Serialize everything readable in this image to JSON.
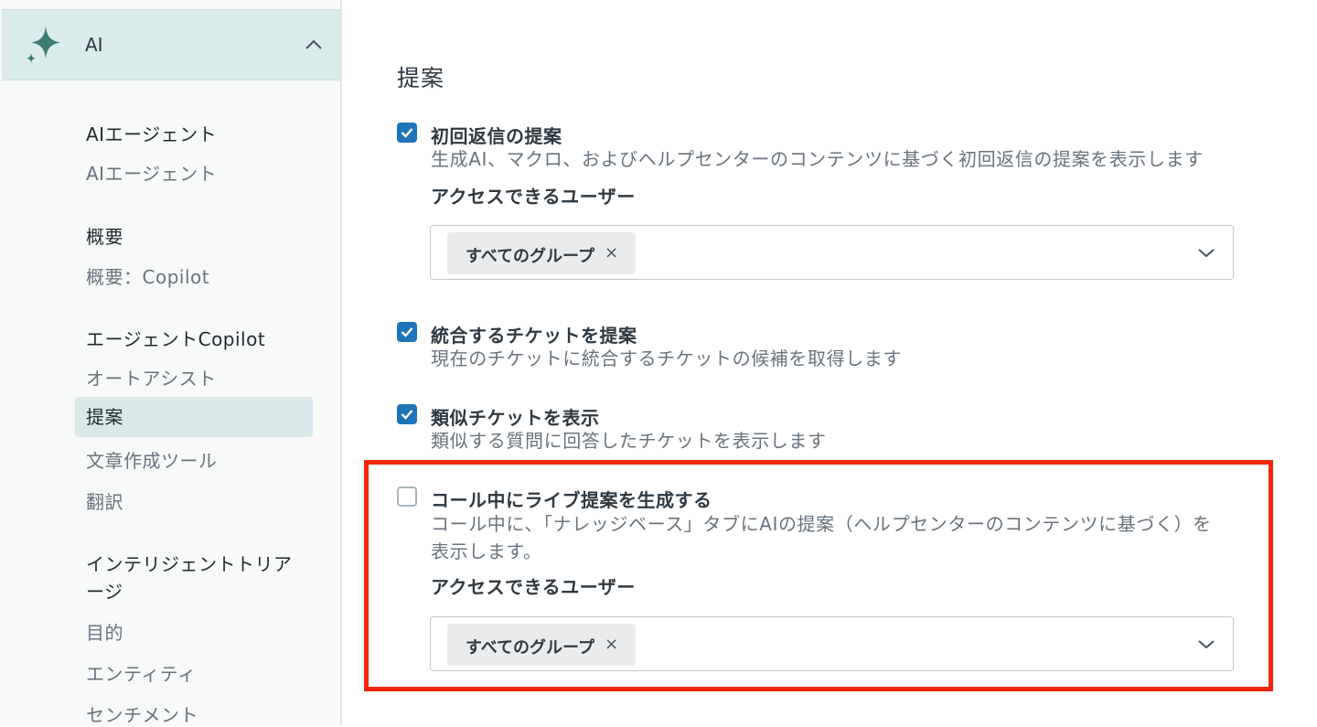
{
  "sidebar": {
    "ai_label": "AI",
    "sections": [
      {
        "title": "AIエージェント",
        "items": [
          "AIエージェント"
        ]
      },
      {
        "title": "概要",
        "items": [
          "概要：Copilot"
        ]
      },
      {
        "title": "エージェントCopilot",
        "items": [
          "オートアシスト",
          "提案",
          "文章作成ツール",
          "翻訳"
        ]
      },
      {
        "title_line1": "インテリジェントトリア",
        "title_line2": "ージ",
        "items": [
          "目的",
          "エンティティ",
          "センチメント"
        ]
      }
    ],
    "selected_item": "提案"
  },
  "main": {
    "title": "提案",
    "options": [
      {
        "title": "初回返信の提案",
        "checked": true,
        "description": "生成AI、マクロ、およびヘルプセンターのコンテンツに基づく初回返信の提案を表示します",
        "access_label": "アクセスできるユーザー",
        "access_tag": "すべてのグループ",
        "tag_remove": "×"
      },
      {
        "title": "統合するチケットを提案",
        "checked": true,
        "description": "現在のチケットに統合するチケットの候補を取得します"
      },
      {
        "title": "類似チケットを表示",
        "checked": true,
        "description": "類似する質問に回答したチケットを表示します"
      },
      {
        "title": "コール中にライブ提案を生成する",
        "checked": false,
        "description_line1": "コール中に、「ナレッジベース」タブにAIの提案（ヘルプセンターのコンテンツに基づく）を",
        "description_line2": "表示します。",
        "access_label": "アクセスできるユーザー",
        "access_tag": "すべてのグループ",
        "tag_remove": "×"
      }
    ]
  },
  "colors": {
    "accent": "#1f73b7",
    "highlight": "#f3260d",
    "ai_header_bg": "#d9ebeb",
    "selected_bg": "#dbe8e9"
  },
  "icons": [
    "sparkle-icon",
    "chevron-up-icon",
    "check-icon",
    "chevron-down-icon",
    "close-icon"
  ]
}
